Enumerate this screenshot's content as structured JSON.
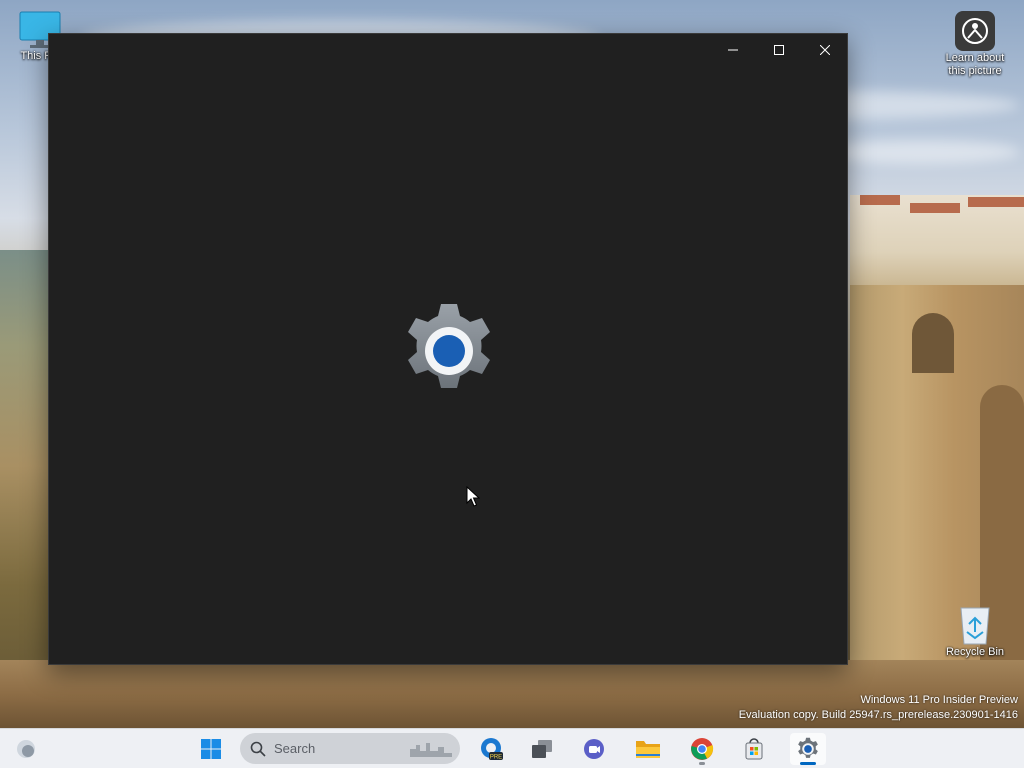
{
  "desktop": {
    "icons": [
      {
        "label": "This PC"
      },
      {
        "label": "Learn about this picture"
      },
      {
        "label": "Recycle Bin"
      }
    ],
    "watermark": {
      "line1": "Windows 11 Pro Insider Preview",
      "line2": "Evaluation copy. Build 25947.rs_prerelease.230901-1416"
    }
  },
  "window": {
    "title": "",
    "app": "Settings",
    "state": "loading splash",
    "caption_buttons": [
      "minimize",
      "maximize",
      "close"
    ],
    "background_color": "#202020"
  },
  "taskbar": {
    "search_placeholder": "Search",
    "items": [
      {
        "icon": "weather-icon"
      },
      {
        "icon": "start-icon"
      },
      {
        "icon": "edge-preview-icon",
        "badge": "PRE"
      },
      {
        "icon": "task-view-icon"
      },
      {
        "icon": "teams-icon"
      },
      {
        "icon": "file-explorer-icon"
      },
      {
        "icon": "chrome-icon",
        "running": true
      },
      {
        "icon": "store-icon"
      },
      {
        "icon": "settings-icon",
        "running": true,
        "active": true
      }
    ],
    "accent_color": "#0067c0"
  }
}
